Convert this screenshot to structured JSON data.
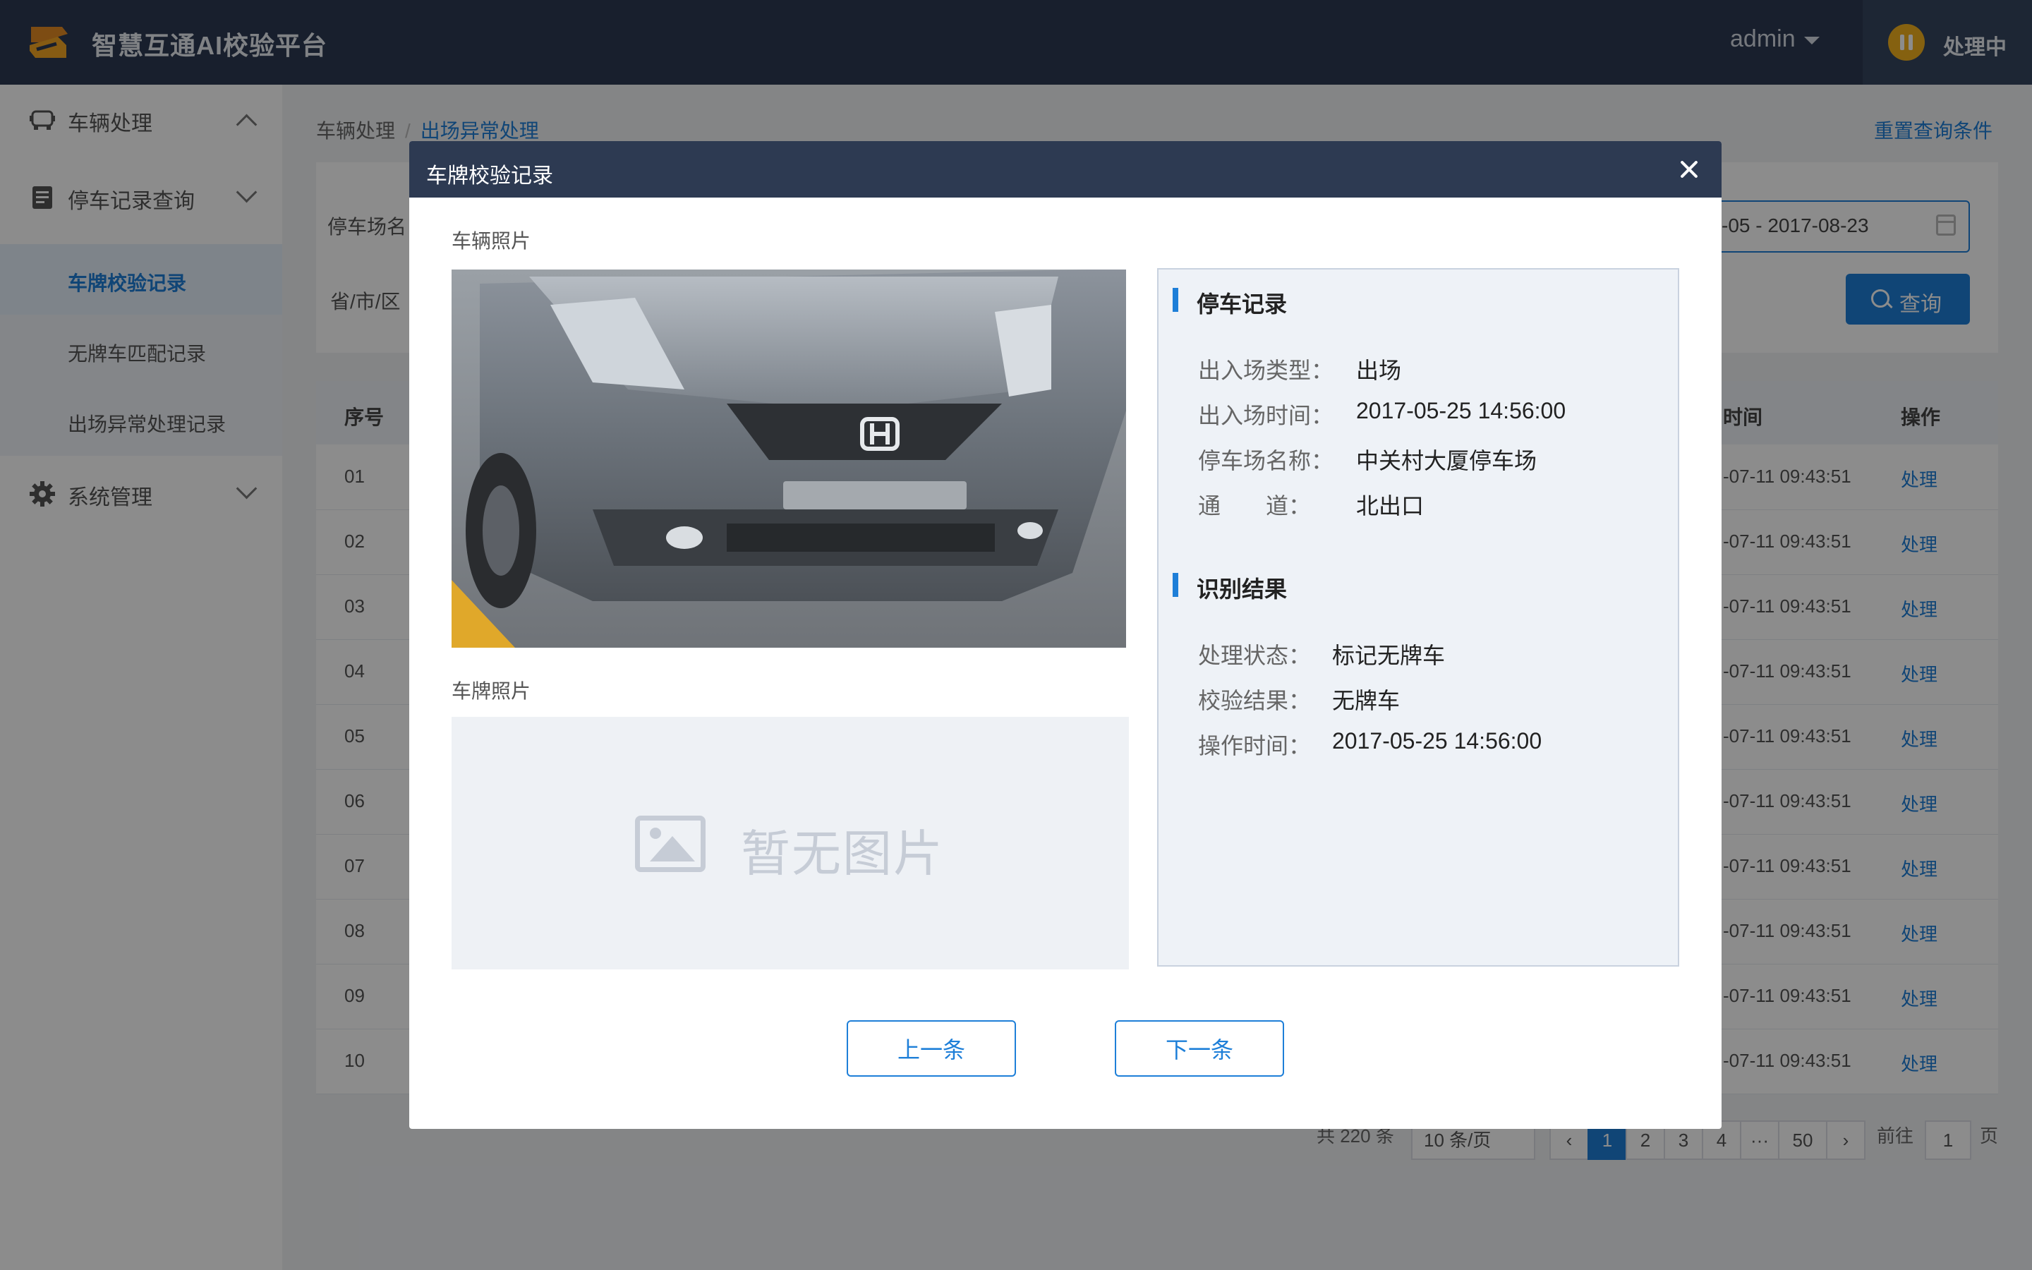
{
  "app": {
    "title": "智慧互通AI校验平台",
    "user": "admin",
    "status": "处理中"
  },
  "sidebar": {
    "groups": [
      {
        "label": "车辆处理"
      },
      {
        "label": "停车记录查询"
      },
      {
        "label": "系统管理"
      }
    ],
    "submenu": [
      {
        "label": "车牌校验记录"
      },
      {
        "label": "无牌车匹配记录"
      },
      {
        "label": "出场异常处理记录"
      }
    ]
  },
  "breadcrumb": {
    "parent": "车辆处理",
    "separator": "/",
    "current": "出场异常处理"
  },
  "filters": {
    "reset": "重置查询条件",
    "parking_label": "停车场名",
    "region_label": "省/市/区",
    "date_range": "-05 - 2017-08-23",
    "search_label": "查询"
  },
  "table": {
    "headers": {
      "index": "序号",
      "time": "时间",
      "action": "操作"
    },
    "rows": [
      {
        "index": "01",
        "time": "-07-11 09:43:51",
        "action": "处理"
      },
      {
        "index": "02",
        "time": "-07-11 09:43:51",
        "action": "处理"
      },
      {
        "index": "03",
        "time": "-07-11 09:43:51",
        "action": "处理"
      },
      {
        "index": "04",
        "time": "-07-11 09:43:51",
        "action": "处理"
      },
      {
        "index": "05",
        "time": "-07-11 09:43:51",
        "action": "处理"
      },
      {
        "index": "06",
        "time": "-07-11 09:43:51",
        "action": "处理"
      },
      {
        "index": "07",
        "time": "-07-11 09:43:51",
        "action": "处理"
      },
      {
        "index": "08",
        "time": "-07-11 09:43:51",
        "action": "处理"
      },
      {
        "index": "09",
        "time": "-07-11 09:43:51",
        "action": "处理"
      },
      {
        "index": "10",
        "time": "-07-11 09:43:51",
        "action": "处理"
      }
    ]
  },
  "pagination": {
    "total": "共 220 条",
    "page_size": "10 条/页",
    "pages": [
      "1",
      "2",
      "3",
      "4",
      "···",
      "50"
    ],
    "goto_label": "前往",
    "goto_value": "1",
    "page_suffix": "页"
  },
  "modal": {
    "title": "车牌校验记录",
    "car_photo_label": "车辆照片",
    "plate_photo_label": "车牌照片",
    "no_image": "暂无图片",
    "parking_section": "停车记录",
    "parking_fields": [
      {
        "key": "出入场类型：",
        "value": "出场"
      },
      {
        "key": "出入场时间：",
        "value": "2017-05-25 14:56:00"
      },
      {
        "key": "停车场名称：",
        "value": "中关村大厦停车场"
      },
      {
        "key": "通　　道：",
        "value": "北出口"
      }
    ],
    "result_section": "识别结果",
    "result_fields": [
      {
        "key": "处理状态：",
        "value": "标记无牌车"
      },
      {
        "key": "校验结果：",
        "value": "无牌车"
      },
      {
        "key": "操作时间：",
        "value": "2017-05-25 14:56:00"
      }
    ],
    "prev_label": "上一条",
    "next_label": "下一条"
  },
  "colors": {
    "header_bg": "#2d3a52",
    "accent": "#1e7fd8",
    "status": "#f3b11e"
  },
  "icons": [
    "logo-icon",
    "car-icon",
    "document-icon",
    "gear-icon",
    "calendar-icon",
    "search-icon",
    "close-icon",
    "image-placeholder-icon",
    "pause-icon"
  ]
}
